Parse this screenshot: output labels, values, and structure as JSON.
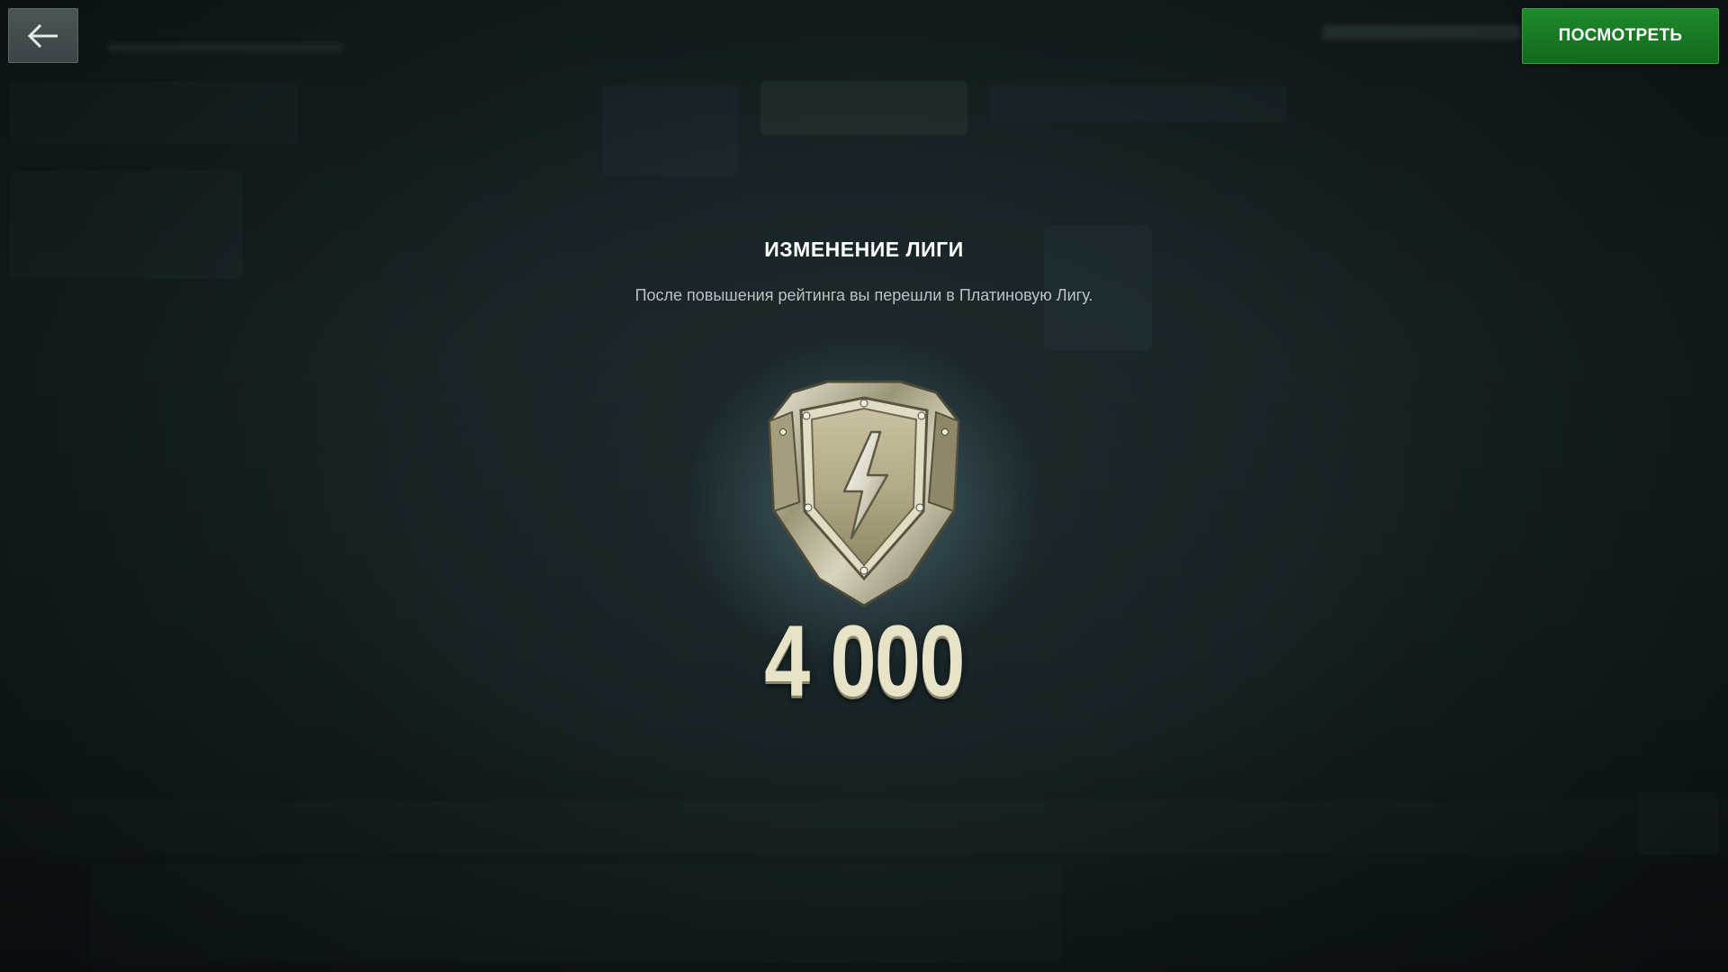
{
  "top_bar": {
    "view_button_label": "ПОСМОТРЕТЬ",
    "back_icon": "arrow-left-icon"
  },
  "dialog": {
    "title": "ИЗМЕНЕНИЕ ЛИГИ",
    "message": "После повышения рейтинга вы перешли в Платиновую Лигу.",
    "league_icon": "platinum-league-shield-icon",
    "rating": "4 000"
  },
  "colors": {
    "background": "#152124",
    "view_button": "#1a7c26",
    "title_text": "#ffffff",
    "message_text": "#b9c3c6",
    "rating_text": "#e8e3c8"
  }
}
